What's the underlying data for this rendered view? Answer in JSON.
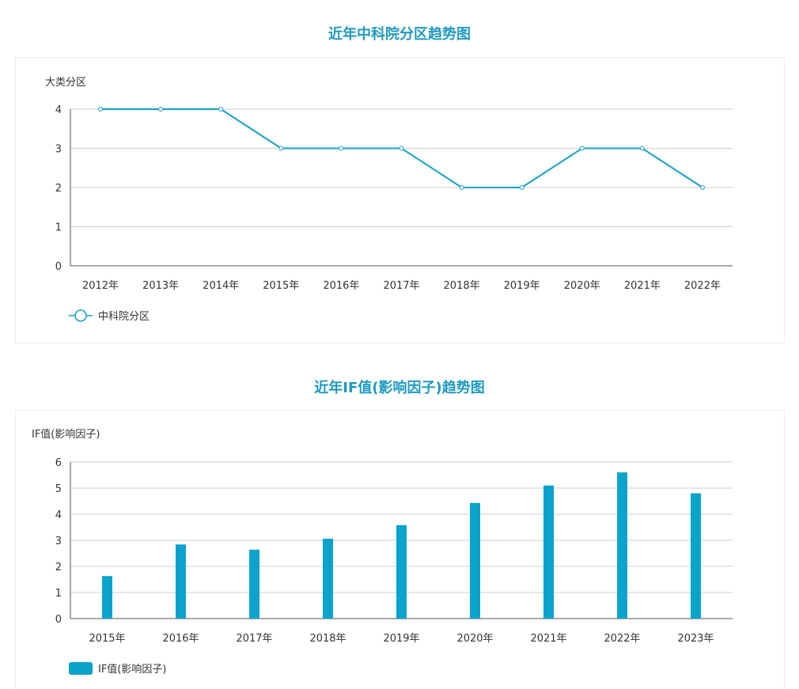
{
  "colors": {
    "accent": "#1e9ac0",
    "line": "#16a0c8",
    "bar": "#0aa3cb"
  },
  "chart_data": [
    {
      "type": "line",
      "title": "近年中科院分区趋势图",
      "ylabel": "大类分区",
      "xlabel": "",
      "categories": [
        "2012年",
        "2013年",
        "2014年",
        "2015年",
        "2016年",
        "2017年",
        "2018年",
        "2019年",
        "2020年",
        "2021年",
        "2022年"
      ],
      "series": [
        {
          "name": "中科院分区",
          "values": [
            4,
            4,
            4,
            3,
            3,
            3,
            2,
            2,
            3,
            3,
            2
          ]
        }
      ],
      "ylim": [
        0,
        4
      ],
      "yticks": [
        0,
        1,
        2,
        3,
        4
      ],
      "grid": true,
      "legend": "bottom-left"
    },
    {
      "type": "bar",
      "title": "近年IF值(影响因子)趋势图",
      "ylabel": "IF值(影响因子)",
      "xlabel": "",
      "categories": [
        "2015年",
        "2016年",
        "2017年",
        "2018年",
        "2019年",
        "2020年",
        "2021年",
        "2022年",
        "2023年"
      ],
      "series": [
        {
          "name": "IF值(影响因子)",
          "values": [
            1.63,
            2.84,
            2.64,
            3.06,
            3.58,
            4.43,
            5.1,
            5.6,
            4.8
          ]
        }
      ],
      "ylim": [
        0,
        6
      ],
      "yticks": [
        0,
        1,
        2,
        3,
        4,
        5,
        6
      ],
      "grid": true,
      "legend": "bottom-left"
    }
  ]
}
